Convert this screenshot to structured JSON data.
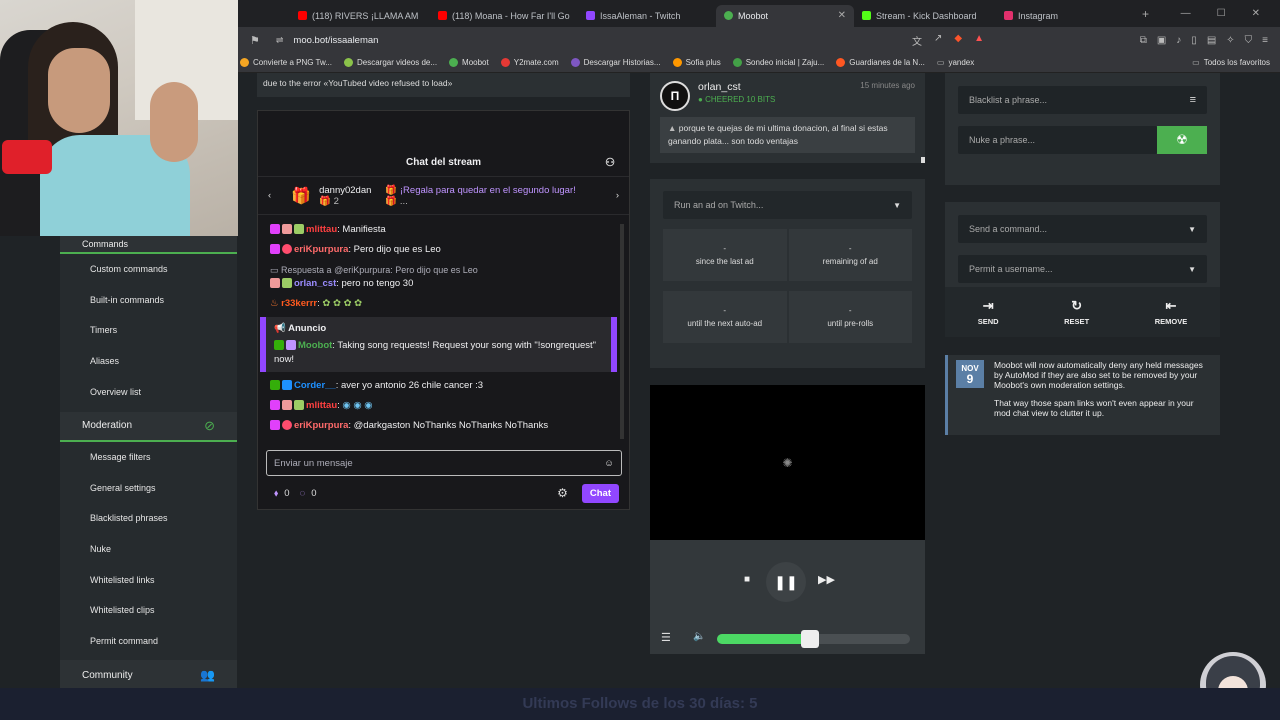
{
  "browser": {
    "tabs": [
      {
        "label": "(118) RIVERS ¡LLAMA AM",
        "color": "#ff0000"
      },
      {
        "label": "(118) Moana - How Far I'll Go",
        "color": "#ff0000"
      },
      {
        "label": "IssaAleman - Twitch",
        "color": "#9147ff"
      },
      {
        "label": "Moobot",
        "color": "#4caf50"
      },
      {
        "label": "Stream - Kick Dashboard",
        "color": "#53fc18"
      },
      {
        "label": "Instagram",
        "color": "#e1306c"
      }
    ],
    "url": "moo.bot/issaaleman",
    "bookmarks": [
      {
        "label": "Convierte a PNG Tw...",
        "color": "#f5a623"
      },
      {
        "label": "Descargar videos de...",
        "color": "#8bc34a"
      },
      {
        "label": "Moobot",
        "color": "#4caf50"
      },
      {
        "label": "Y2mate.com",
        "color": "#e53935"
      },
      {
        "label": "Descargar Historias...",
        "color": "#7e57c2"
      },
      {
        "label": "Sofia plus",
        "color": "#ff9800"
      },
      {
        "label": "Sondeo inicial | Zaju...",
        "color": "#43a047"
      },
      {
        "label": "Guardianes de la N...",
        "color": "#ff5722"
      },
      {
        "label": "yandex",
        "color": "#999999"
      }
    ],
    "all_bookmarks": "Todos los favoritos"
  },
  "sidebar": {
    "commands_header": "Commands",
    "command_items": [
      "Custom commands",
      "Built-in commands",
      "Timers",
      "Aliases",
      "Overview list"
    ],
    "moderation_header": "Moderation",
    "moderation_items": [
      "Message filters",
      "General settings",
      "Blacklisted phrases",
      "Nuke",
      "Whitelisted links",
      "Whitelisted clips",
      "Permit command"
    ],
    "community_header": "Community"
  },
  "top_note": "due to the error «YouTubed video refused to load»",
  "chat": {
    "title": "Chat del stream",
    "pinned_user": "danny02dan",
    "pinned_count": "2",
    "pinned_text": "¡Regala para quedar en el segundo lugar!",
    "pinned_more": "...",
    "messages": [
      {
        "user": "mlittau",
        "color": "#ff4040",
        "text": ": Manifiesta"
      },
      {
        "user": "eriKpurpura",
        "color": "#ff6b6b",
        "text": ": Pero dijo que es Leo"
      },
      {
        "reply": "Respuesta a @eriKpurpura: Pero dijo que es Leo"
      },
      {
        "user": "orlan_cst",
        "color": "#9b8cff",
        "text": ": pero no tengo 30"
      },
      {
        "user": "r33kerrr",
        "color": "#ff5a1f",
        "text": ":"
      }
    ],
    "announcement_title": "Anuncio",
    "announcement_user": "Moobot",
    "announcement_text": ": Taking song requests! Request your song with \"!songrequest\" now!",
    "messages2": [
      {
        "user": "Corder__",
        "color": "#1e90ff",
        "text": ": aver yo antonio 26 chile cancer :3"
      },
      {
        "user": "mlittau",
        "color": "#ff4040",
        "text": ":"
      },
      {
        "user": "eriKpurpura",
        "color": "#ff6b6b",
        "text": ": @darkgaston NoThanks NoThanks NoThanks"
      }
    ],
    "input_placeholder": "Enviar un mensaje",
    "points": "0",
    "bits": "0",
    "send_label": "Chat"
  },
  "cheer": {
    "user": "orlan_cst",
    "status": "CHEERED 10 BITS",
    "time": "15 minutes ago",
    "text": "porque te quejas de mi ultima donacion, al final si estas ganando plata... son todo ventajas"
  },
  "ads": {
    "select_placeholder": "Run an ad on Twitch...",
    "stats": [
      {
        "value": "-",
        "label": "since the last ad"
      },
      {
        "value": "-",
        "label": "remaining of ad"
      },
      {
        "value": "-",
        "label": "until the next auto-ad"
      },
      {
        "value": "-",
        "label": "until pre-rolls"
      }
    ]
  },
  "player": {
    "volume_percent": 48
  },
  "moderation": {
    "blacklist_placeholder": "Blacklist a phrase...",
    "nuke_placeholder": "Nuke a phrase...",
    "send_command_placeholder": "Send a command...",
    "permit_placeholder": "Permit a username...",
    "actions": [
      "SEND",
      "RESET",
      "REMOVE"
    ]
  },
  "news": {
    "month": "NOV",
    "day": "9",
    "text1": "Moobot will now automatically deny any held messages by AutoMod if they are also set to be removed by your Moobot's own moderation settings.",
    "text2": "That way those spam links won't even appear in your mod chat view to clutter it up."
  },
  "footer_text": "Ultimos Follows de los 30 días: 5"
}
